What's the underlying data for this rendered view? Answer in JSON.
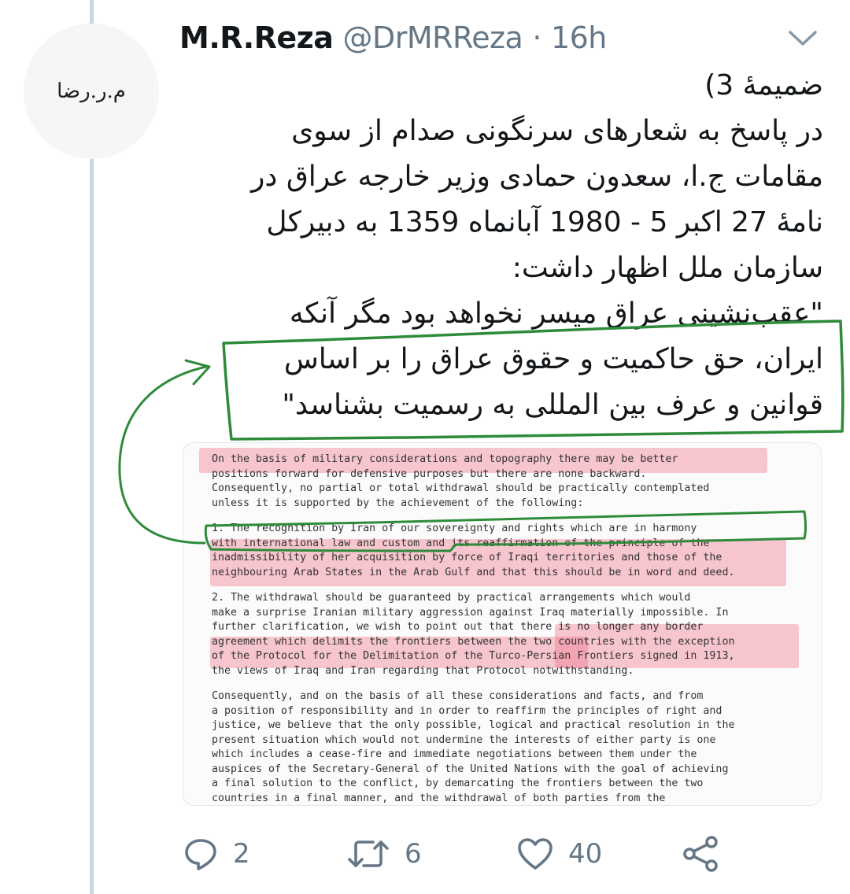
{
  "tweet": {
    "author_name": "M.R.Reza",
    "handle": "@DrMRReza",
    "separator": "·",
    "time": "16h",
    "avatar_text": "م.ر.رضا",
    "text_lines": [
      "ضمیمۀ 3)",
      "در پاسخ به شعارهای سرنگونی صدام از سوی",
      "مقامات ج.ا، سعدون حمادی وزیر خارجه عراق در",
      "نامۀ 27 اکبر 5 - 1980 آبانماه 1359 به دبیرکل",
      "سازمان ملل اظهار داشت:",
      "\"عقب‌نشینی عراق میسر نخواهد بود مگر آنکه",
      "ایران، حق حاکمیت و حقوق عراق را بر اساس",
      "قوانین و عرف بین المللی به رسمیت بشناسد\""
    ]
  },
  "document": {
    "paragraphs": [
      [
        "    On the basis of military considerations and topography there may be better",
        "positions forward for defensive purposes but there are none backward.",
        "Consequently, no partial or total withdrawal should be practically contemplated",
        "unless it is supported by the achievement of the following:"
      ],
      [
        "    1.  The recognition by Iran of our sovereignty and rights which are in harmony",
        "with international law and custom and its reaffirmation of the principle of the",
        "inadmissibility of her acquisition by force of Iraqi territories and those of the",
        "neighbouring Arab States in the Arab Gulf and that this should be in word and deed."
      ],
      [
        "    2.   The withdrawal should be guaranteed by practical arrangements which would",
        "make a surprise Iranian military aggression against Iraq materially impossible.  In",
        "further clarification, we wish to point out that there is no longer any border",
        "agreement which delimits the frontiers between the two countries with the exception",
        "of the Protocol for the Delimitation of the Turco-Persian Frontiers signed in 1913,",
        "the views of Iraq and Iran regarding that Protocol notwithstanding."
      ],
      [
        "    Consequently, and on the basis of all these considerations and facts, and from",
        "a position of responsibility and in order to reaffirm the principles of right and",
        "justice, we believe that the only possible, logical and practical resolution in the",
        "present situation which would not undermine the interests of either party is one",
        "which includes a cease-fire and immediate negotiations between them under the",
        "auspices of the Secretary-General of the United Nations with the goal of achieving",
        "a final solution to the conflict, by demarcating the frontiers between the two",
        "countries in a final manner, and the withdrawal of both parties from the"
      ]
    ]
  },
  "actions": {
    "reply_count": "2",
    "retweet_count": "6",
    "like_count": "40"
  },
  "colors": {
    "annotation_green": "#2e8b3a",
    "highlight_pink": "#f06e87",
    "meta_gray": "#657786",
    "thread_line": "#ccd6dd"
  },
  "icons": [
    "reply-icon",
    "retweet-icon",
    "like-icon",
    "share-icon",
    "chevron-down-icon"
  ]
}
